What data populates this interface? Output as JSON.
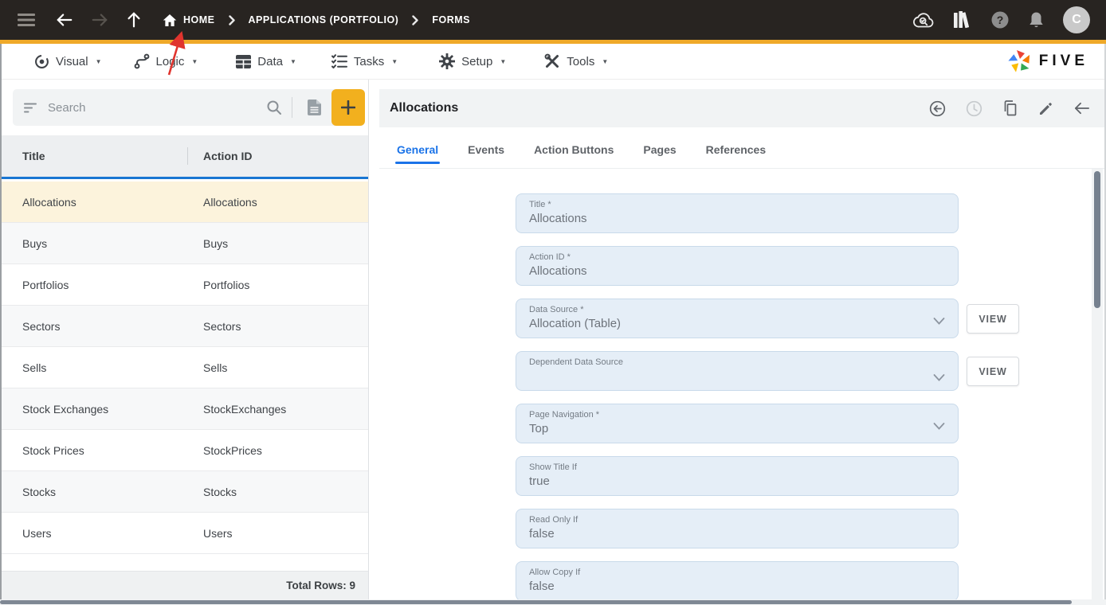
{
  "navbar": {
    "breadcrumb": {
      "home": "HOME",
      "app": "APPLICATIONS (PORTFOLIO)",
      "section": "FORMS"
    },
    "avatar_initial": "C",
    "icons": [
      "menu-icon",
      "arrow-back-icon",
      "arrow-forward-icon",
      "arrow-up-icon",
      "home-icon",
      "cloud-search-icon",
      "library-icon",
      "help-icon",
      "notifications-icon"
    ]
  },
  "menubar": {
    "items": [
      {
        "label": "Visual",
        "icon": "visual-icon"
      },
      {
        "label": "Logic",
        "icon": "logic-icon"
      },
      {
        "label": "Data",
        "icon": "data-icon"
      },
      {
        "label": "Tasks",
        "icon": "tasks-icon"
      },
      {
        "label": "Setup",
        "icon": "setup-icon"
      },
      {
        "label": "Tools",
        "icon": "tools-icon"
      }
    ],
    "logo_text": "FIVE"
  },
  "left_panel": {
    "search_placeholder": "Search",
    "columns": [
      "Title",
      "Action ID"
    ],
    "rows": [
      {
        "title": "Allocations",
        "action_id": "Allocations",
        "selected": true
      },
      {
        "title": "Buys",
        "action_id": "Buys"
      },
      {
        "title": "Portfolios",
        "action_id": "Portfolios"
      },
      {
        "title": "Sectors",
        "action_id": "Sectors"
      },
      {
        "title": "Sells",
        "action_id": "Sells"
      },
      {
        "title": "Stock Exchanges",
        "action_id": "StockExchanges"
      },
      {
        "title": "Stock Prices",
        "action_id": "StockPrices"
      },
      {
        "title": "Stocks",
        "action_id": "Stocks"
      },
      {
        "title": "Users",
        "action_id": "Users"
      }
    ],
    "footer": "Total Rows: 9",
    "icons": [
      "filter-icon",
      "search-icon",
      "copy-record-icon",
      "add-icon"
    ]
  },
  "detail_panel": {
    "title": "Allocations",
    "tabs": [
      {
        "label": "General",
        "active": true
      },
      {
        "label": "Events"
      },
      {
        "label": "Action Buttons"
      },
      {
        "label": "Pages"
      },
      {
        "label": "References"
      }
    ],
    "header_icons": [
      "return-icon",
      "history-icon",
      "copy-icon",
      "edit-icon",
      "back-arrow-icon"
    ],
    "fields": [
      {
        "label": "Title *",
        "value": "Allocations"
      },
      {
        "label": "Action ID *",
        "value": "Allocations"
      },
      {
        "label": "Data Source *",
        "value": "Allocation (Table)",
        "view_button": "VIEW"
      },
      {
        "label": "Dependent Data Source",
        "value": "",
        "view_button": "VIEW"
      },
      {
        "label": "Page Navigation *",
        "value": "Top"
      },
      {
        "label": "Show Title If",
        "value": "true"
      },
      {
        "label": "Read Only If",
        "value": "false"
      },
      {
        "label": "Allow Copy If",
        "value": "false"
      }
    ]
  },
  "colors": {
    "navbar_bg": "#282421",
    "accent_amber": "#efa929",
    "accent_yellow": "#f2b01e",
    "accent_blue": "#1a73e8",
    "selected_row_bg": "#fcf3dc",
    "field_bg": "#e5eef7",
    "annotation_red": "#e0342e"
  }
}
